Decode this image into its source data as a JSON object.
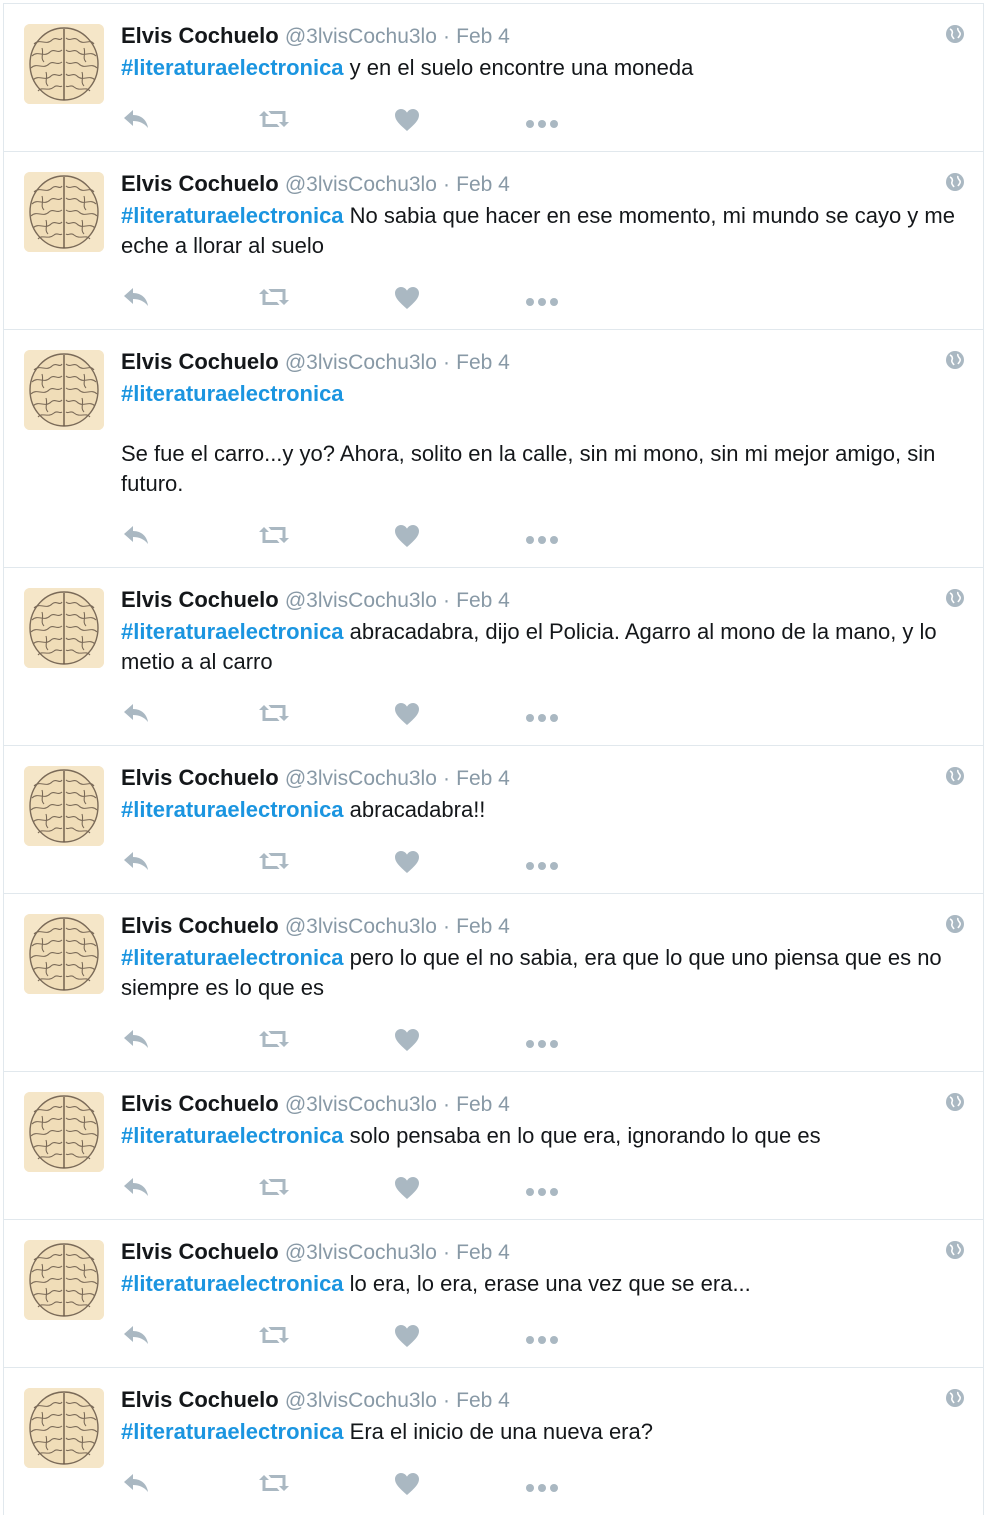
{
  "colors": {
    "hashtag": "#1b95e0",
    "meta": "#8899a6",
    "icon": "#aab8c2",
    "border": "#e1e8ed",
    "avatar_bg": "#f5e6c8"
  },
  "icons": {
    "reply": "reply-icon",
    "retweet": "retweet-icon",
    "like": "heart-icon",
    "more": "more-icon",
    "globe": "globe-icon",
    "avatar": "brain-illustration"
  },
  "tweets": [
    {
      "name": "Elvis Cochuelo",
      "handle": "@3lvisCochu3lo",
      "date": "Feb 4",
      "hashtag": "#literaturaelectronica",
      "text": " y en el suelo encontre una moneda"
    },
    {
      "name": "Elvis Cochuelo",
      "handle": "@3lvisCochu3lo",
      "date": "Feb 4",
      "hashtag": "#literaturaelectronica",
      "text": " No sabia que hacer en ese momento, mi mundo se cayo y me eche a llorar al suelo"
    },
    {
      "name": "Elvis Cochuelo",
      "handle": "@3lvisCochu3lo",
      "date": "Feb 4",
      "hashtag": "#literaturaelectronica",
      "text": "\n\nSe fue el carro...y yo? Ahora, solito en la calle, sin mi mono, sin mi mejor amigo, sin futuro."
    },
    {
      "name": "Elvis Cochuelo",
      "handle": "@3lvisCochu3lo",
      "date": "Feb 4",
      "hashtag": "#literaturaelectronica",
      "text": " abracadabra, dijo el Policia. Agarro al mono de la mano, y lo metio a al carro"
    },
    {
      "name": "Elvis Cochuelo",
      "handle": "@3lvisCochu3lo",
      "date": "Feb 4",
      "hashtag": "#literaturaelectronica",
      "text": " abracadabra!!"
    },
    {
      "name": "Elvis Cochuelo",
      "handle": "@3lvisCochu3lo",
      "date": "Feb 4",
      "hashtag": "#literaturaelectronica",
      "text": " pero lo que el no sabia, era que lo que uno piensa que es no siempre es lo que es"
    },
    {
      "name": "Elvis Cochuelo",
      "handle": "@3lvisCochu3lo",
      "date": "Feb 4",
      "hashtag": "#literaturaelectronica",
      "text": " solo pensaba en lo que era, ignorando lo que es"
    },
    {
      "name": "Elvis Cochuelo",
      "handle": "@3lvisCochu3lo",
      "date": "Feb 4",
      "hashtag": "#literaturaelectronica",
      "text": " lo era, lo era, erase una vez que se era..."
    },
    {
      "name": "Elvis Cochuelo",
      "handle": "@3lvisCochu3lo",
      "date": "Feb 4",
      "hashtag": "#literaturaelectronica",
      "text": " Era el inicio de una nueva era?"
    }
  ]
}
